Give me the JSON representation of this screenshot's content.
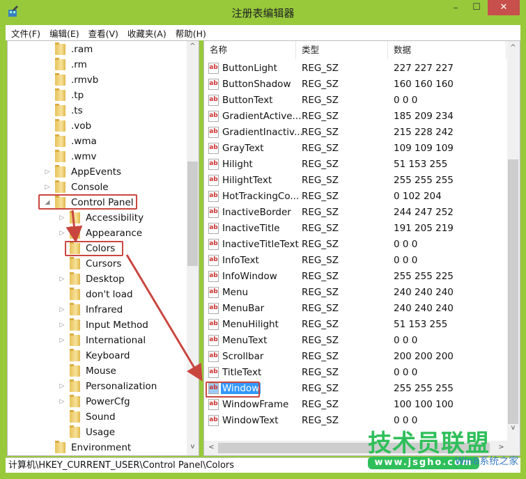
{
  "window": {
    "title": "注册表编辑器",
    "minimize": "–",
    "maximize": "☐",
    "close": "✕",
    "accent": "#97c93b"
  },
  "menu": [
    "文件(F)",
    "编辑(E)",
    "查看(V)",
    "收藏夹(A)",
    "帮助(H)"
  ],
  "tree": [
    {
      "label": ".ram",
      "level": 1,
      "expander": ""
    },
    {
      "label": ".rm",
      "level": 1,
      "expander": ""
    },
    {
      "label": ".rmvb",
      "level": 1,
      "expander": ""
    },
    {
      "label": ".tp",
      "level": 1,
      "expander": ""
    },
    {
      "label": ".ts",
      "level": 1,
      "expander": ""
    },
    {
      "label": ".vob",
      "level": 1,
      "expander": ""
    },
    {
      "label": ".wma",
      "level": 1,
      "expander": ""
    },
    {
      "label": ".wmv",
      "level": 1,
      "expander": ""
    },
    {
      "label": "AppEvents",
      "level": 1,
      "expander": "▷"
    },
    {
      "label": "Console",
      "level": 1,
      "expander": "▷"
    },
    {
      "label": "Control Panel",
      "level": 1,
      "expander": "◢"
    },
    {
      "label": "Accessibility",
      "level": 2,
      "expander": "▷"
    },
    {
      "label": "Appearance",
      "level": 2,
      "expander": "▷"
    },
    {
      "label": "Colors",
      "level": 2,
      "expander": ""
    },
    {
      "label": "Cursors",
      "level": 2,
      "expander": ""
    },
    {
      "label": "Desktop",
      "level": 2,
      "expander": "▷"
    },
    {
      "label": "don't load",
      "level": 2,
      "expander": ""
    },
    {
      "label": "Infrared",
      "level": 2,
      "expander": "▷"
    },
    {
      "label": "Input Method",
      "level": 2,
      "expander": "▷"
    },
    {
      "label": "International",
      "level": 2,
      "expander": "▷"
    },
    {
      "label": "Keyboard",
      "level": 2,
      "expander": ""
    },
    {
      "label": "Mouse",
      "level": 2,
      "expander": ""
    },
    {
      "label": "Personalization",
      "level": 2,
      "expander": "▷"
    },
    {
      "label": "PowerCfg",
      "level": 2,
      "expander": "▷"
    },
    {
      "label": "Sound",
      "level": 2,
      "expander": ""
    },
    {
      "label": "Usage",
      "level": 2,
      "expander": ""
    },
    {
      "label": "Environment",
      "level": 1,
      "expander": ""
    }
  ],
  "list": {
    "headers": [
      "名称",
      "类型",
      "数据"
    ],
    "rows": [
      [
        "ButtonLight",
        "REG_SZ",
        "227 227 227"
      ],
      [
        "ButtonShadow",
        "REG_SZ",
        "160 160 160"
      ],
      [
        "ButtonText",
        "REG_SZ",
        "0 0 0"
      ],
      [
        "GradientActive...",
        "REG_SZ",
        "185 209 234"
      ],
      [
        "GradientInactiv...",
        "REG_SZ",
        "215 228 242"
      ],
      [
        "GrayText",
        "REG_SZ",
        "109 109 109"
      ],
      [
        "Hilight",
        "REG_SZ",
        "51 153 255"
      ],
      [
        "HilightText",
        "REG_SZ",
        "255 255 255"
      ],
      [
        "HotTrackingCo...",
        "REG_SZ",
        "0 102 204"
      ],
      [
        "InactiveBorder",
        "REG_SZ",
        "244 247 252"
      ],
      [
        "InactiveTitle",
        "REG_SZ",
        "191 205 219"
      ],
      [
        "InactiveTitleText",
        "REG_SZ",
        "0 0 0"
      ],
      [
        "InfoText",
        "REG_SZ",
        "0 0 0"
      ],
      [
        "InfoWindow",
        "REG_SZ",
        "255 255 225"
      ],
      [
        "Menu",
        "REG_SZ",
        "240 240 240"
      ],
      [
        "MenuBar",
        "REG_SZ",
        "240 240 240"
      ],
      [
        "MenuHilight",
        "REG_SZ",
        "51 153 255"
      ],
      [
        "MenuText",
        "REG_SZ",
        "0 0 0"
      ],
      [
        "Scrollbar",
        "REG_SZ",
        "200 200 200"
      ],
      [
        "TitleText",
        "REG_SZ",
        "0 0 0"
      ],
      [
        "Window",
        "REG_SZ",
        "255 255 255"
      ],
      [
        "WindowFrame",
        "REG_SZ",
        "100 100 100"
      ],
      [
        "WindowText",
        "REG_SZ",
        "0 0 0"
      ]
    ],
    "selected": "Window",
    "value_icon": "ab"
  },
  "status": "计算机\\HKEY_CURRENT_USER\\Control Panel\\Colors",
  "watermark": {
    "logo": "技术员联盟",
    "url": "www.jsgho.com",
    "sub": "Win8系统之家"
  },
  "annotation_color": "#c9463f"
}
